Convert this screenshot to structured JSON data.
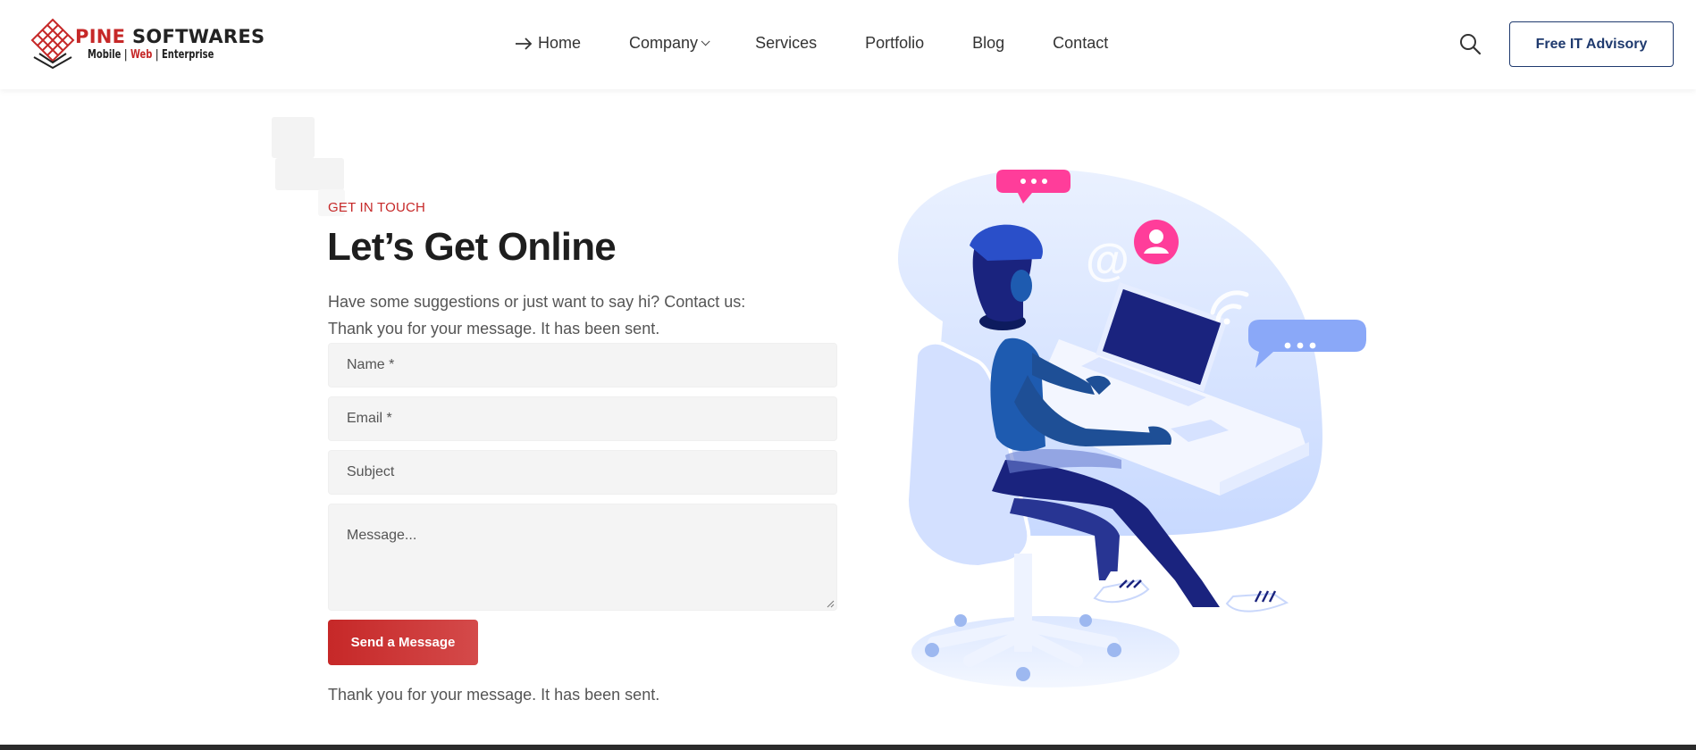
{
  "brand": {
    "title_part1": "PINE",
    "title_part2": "SOFTWARES",
    "sub_part1": "Mobile",
    "sub_sep1": "|",
    "sub_part2": "Web",
    "sub_sep2": "|",
    "sub_part3": "Enterprise",
    "accent_color": "#c62828",
    "dark_color": "#222222"
  },
  "nav": {
    "items": [
      {
        "label": "Home",
        "icon": "arrow-right-icon"
      },
      {
        "label": "Company",
        "icon": "chevron-down-icon"
      },
      {
        "label": "Services"
      },
      {
        "label": "Portfolio"
      },
      {
        "label": "Blog"
      },
      {
        "label": "Contact"
      }
    ]
  },
  "header": {
    "search_icon": "search-icon",
    "advisory_label": "Free IT Advisory",
    "advisory_color": "#1f3a6e"
  },
  "contact": {
    "eyebrow": "GET IN TOUCH",
    "headline": "Let’s Get Online",
    "lead": "Have some suggestions or just want to say hi? Contact us:",
    "sent_message_top": "Thank you for your message. It has been sent.",
    "fields": {
      "name_placeholder": "Name *",
      "email_placeholder": "Email *",
      "subject_placeholder": "Subject",
      "message_placeholder": "Message..."
    },
    "submit_label": "Send a Message",
    "sent_message_bottom": "Thank you for your message. It has been sent."
  },
  "illustration": {
    "subject": "person-at-laptop-illustration",
    "bubble_color_pink": "#ff3d9a",
    "bubble_color_blue": "#8aa8f8",
    "navy": "#1a237e"
  }
}
